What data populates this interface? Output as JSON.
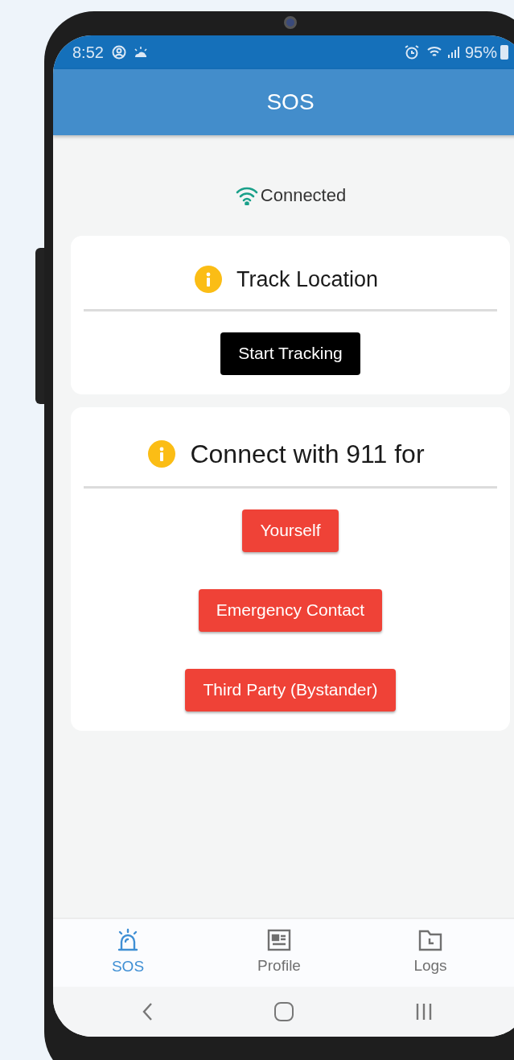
{
  "status_bar": {
    "time": "8:52",
    "battery": "95%"
  },
  "header": {
    "title": "SOS"
  },
  "connection": {
    "label": "Connected"
  },
  "cards": [
    {
      "title": "Track Location",
      "buttons": [
        {
          "label": "Start Tracking",
          "kind": "dark"
        }
      ]
    },
    {
      "title": "Connect with 911 for",
      "buttons": [
        {
          "label": "Yourself",
          "kind": "danger"
        },
        {
          "label": "Emergency Contact",
          "kind": "danger"
        },
        {
          "label": "Third Party (Bystander)",
          "kind": "danger"
        }
      ]
    }
  ],
  "tabs": [
    {
      "label": "SOS",
      "kind": "alarm",
      "selected": true
    },
    {
      "label": "Profile",
      "kind": "card",
      "selected": false
    },
    {
      "label": "Logs",
      "kind": "folder",
      "selected": false
    }
  ]
}
